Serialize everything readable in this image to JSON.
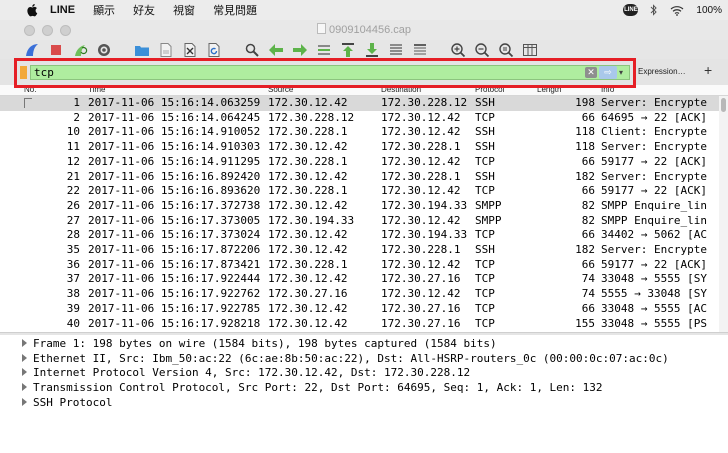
{
  "menubar": {
    "app_name": "LINE",
    "items": [
      "顯示",
      "好友",
      "視窗",
      "常見問題"
    ],
    "line_badge": "LINE",
    "battery": "100%"
  },
  "window": {
    "title": "0909104456.cap"
  },
  "toolbar": {
    "icons": [
      "shark-fin-start-icon",
      "stop-icon",
      "restart-icon",
      "options-gear-icon",
      "open-folder-icon",
      "save-file-icon",
      "close-file-icon",
      "reload-icon",
      "find-icon",
      "back-arrow-icon",
      "forward-arrow-icon",
      "go-to-packet-icon",
      "first-packet-icon",
      "last-packet-icon",
      "autoscroll-icon",
      "colorize-icon",
      "zoom-in-icon",
      "zoom-out-icon",
      "normal-size-icon",
      "resize-columns-icon"
    ]
  },
  "filter": {
    "value": "tcp",
    "expression_label": "Expression…",
    "add_label": "+"
  },
  "columns": [
    "No.",
    "Time",
    "Source",
    "Destination",
    "Protocol",
    "Length",
    "Info"
  ],
  "packets": [
    {
      "no": "1",
      "time": "2017-11-06 15:16:14.063259",
      "src": "172.30.12.42",
      "dst": "172.30.228.12",
      "proto": "SSH",
      "len": "198",
      "info": "Server: Encrypte"
    },
    {
      "no": "2",
      "time": "2017-11-06 15:16:14.064245",
      "src": "172.30.228.12",
      "dst": "172.30.12.42",
      "proto": "TCP",
      "len": "66",
      "info": "64695 → 22 [ACK]"
    },
    {
      "no": "10",
      "time": "2017-11-06 15:16:14.910052",
      "src": "172.30.228.1",
      "dst": "172.30.12.42",
      "proto": "SSH",
      "len": "118",
      "info": "Client: Encrypte"
    },
    {
      "no": "11",
      "time": "2017-11-06 15:16:14.910303",
      "src": "172.30.12.42",
      "dst": "172.30.228.1",
      "proto": "SSH",
      "len": "118",
      "info": "Server: Encrypte"
    },
    {
      "no": "12",
      "time": "2017-11-06 15:16:14.911295",
      "src": "172.30.228.1",
      "dst": "172.30.12.42",
      "proto": "TCP",
      "len": "66",
      "info": "59177 → 22 [ACK]"
    },
    {
      "no": "21",
      "time": "2017-11-06 15:16:16.892420",
      "src": "172.30.12.42",
      "dst": "172.30.228.1",
      "proto": "SSH",
      "len": "182",
      "info": "Server: Encrypte"
    },
    {
      "no": "22",
      "time": "2017-11-06 15:16:16.893620",
      "src": "172.30.228.1",
      "dst": "172.30.12.42",
      "proto": "TCP",
      "len": "66",
      "info": "59177 → 22 [ACK]"
    },
    {
      "no": "26",
      "time": "2017-11-06 15:16:17.372738",
      "src": "172.30.12.42",
      "dst": "172.30.194.33",
      "proto": "SMPP",
      "len": "82",
      "info": "SMPP Enquire_lin"
    },
    {
      "no": "27",
      "time": "2017-11-06 15:16:17.373005",
      "src": "172.30.194.33",
      "dst": "172.30.12.42",
      "proto": "SMPP",
      "len": "82",
      "info": "SMPP Enquire_lin"
    },
    {
      "no": "28",
      "time": "2017-11-06 15:16:17.373024",
      "src": "172.30.12.42",
      "dst": "172.30.194.33",
      "proto": "TCP",
      "len": "66",
      "info": "34402 → 5062 [AC"
    },
    {
      "no": "35",
      "time": "2017-11-06 15:16:17.872206",
      "src": "172.30.12.42",
      "dst": "172.30.228.1",
      "proto": "SSH",
      "len": "182",
      "info": "Server: Encrypte"
    },
    {
      "no": "36",
      "time": "2017-11-06 15:16:17.873421",
      "src": "172.30.228.1",
      "dst": "172.30.12.42",
      "proto": "TCP",
      "len": "66",
      "info": "59177 → 22 [ACK]"
    },
    {
      "no": "37",
      "time": "2017-11-06 15:16:17.922444",
      "src": "172.30.12.42",
      "dst": "172.30.27.16",
      "proto": "TCP",
      "len": "74",
      "info": "33048 → 5555 [SY"
    },
    {
      "no": "38",
      "time": "2017-11-06 15:16:17.922762",
      "src": "172.30.27.16",
      "dst": "172.30.12.42",
      "proto": "TCP",
      "len": "74",
      "info": "5555 → 33048 [SY"
    },
    {
      "no": "39",
      "time": "2017-11-06 15:16:17.922785",
      "src": "172.30.12.42",
      "dst": "172.30.27.16",
      "proto": "TCP",
      "len": "66",
      "info": "33048 → 5555 [AC"
    },
    {
      "no": "40",
      "time": "2017-11-06 15:16:17.928218",
      "src": "172.30.12.42",
      "dst": "172.30.27.16",
      "proto": "TCP",
      "len": "155",
      "info": "33048 → 5555 [PS"
    }
  ],
  "details": [
    "Frame 1: 198 bytes on wire (1584 bits), 198 bytes captured (1584 bits)",
    "Ethernet II, Src: Ibm_50:ac:22 (6c:ae:8b:50:ac:22), Dst: All-HSRP-routers_0c (00:00:0c:07:ac:0c)",
    "Internet Protocol Version 4, Src: 172.30.12.42, Dst: 172.30.228.12",
    "Transmission Control Protocol, Src Port: 22, Dst Port: 64695, Seq: 1, Ack: 1, Len: 132",
    "SSH Protocol"
  ],
  "colors": {
    "filter_bg": "#afed9f",
    "highlight_border": "#e51e25",
    "selected_row": "#d9d9d9"
  }
}
